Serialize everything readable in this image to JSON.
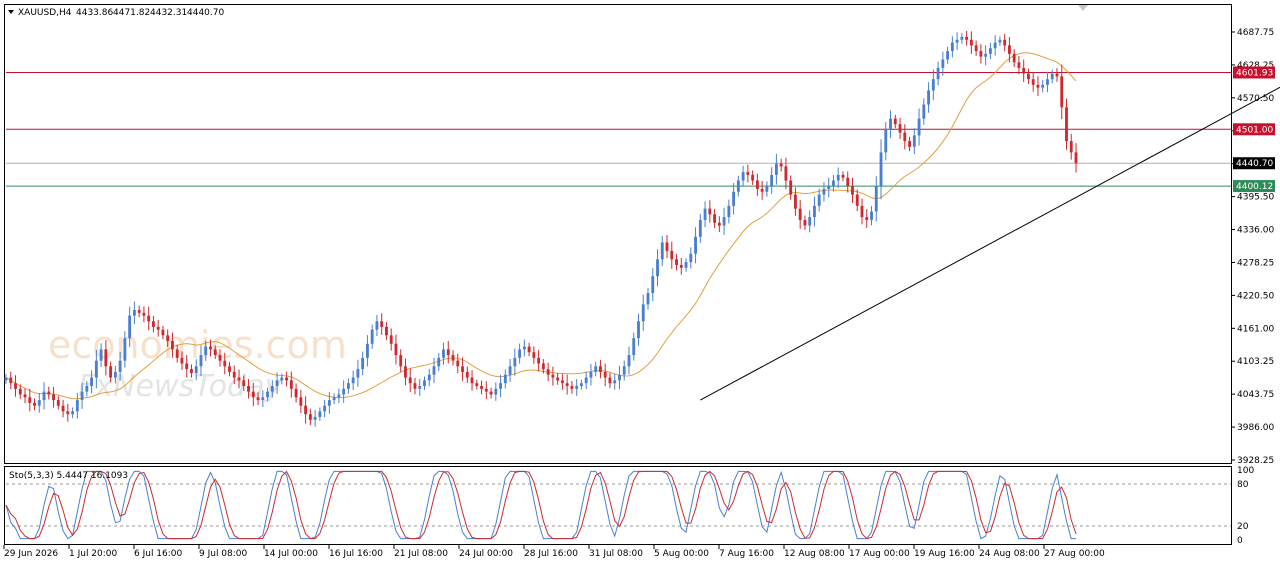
{
  "chart_data": {
    "type": "candlestick",
    "symbol_header": "XAUUSD,H4",
    "ohlc_header": [
      "4433.86",
      "4471.82",
      "4432.31",
      "4440.70"
    ],
    "price_axis": {
      "ylim": [
        3910,
        4720
      ],
      "ticks": [
        "4687.75",
        "4628.25",
        "4570.50",
        "4511.00",
        "4453.25",
        "4395.50",
        "4336.00",
        "4278.25",
        "4220.50",
        "4161.00",
        "4103.25",
        "4043.75",
        "3986.00",
        "3928.25"
      ]
    },
    "time_axis": {
      "ticks": [
        "29 Jun 2026",
        "1 Jul 20:00",
        "6 Jul 16:00",
        "9 Jul 08:00",
        "14 Jul 00:00",
        "16 Jul 16:00",
        "21 Jul 08:00",
        "24 Jul 00:00",
        "28 Jul 16:00",
        "31 Jul 08:00",
        "5 Aug 00:00",
        "7 Aug 16:00",
        "12 Aug 08:00",
        "17 Aug 00:00",
        "19 Aug 16:00",
        "24 Aug 08:00",
        "27 Aug 00:00"
      ]
    },
    "horizontal_levels": [
      {
        "value": 4601.93,
        "label": "4601.93",
        "color": "#c8102e"
      },
      {
        "value": 4501.0,
        "label": "4501.00",
        "color": "#c8102e"
      },
      {
        "value": 4440.7,
        "label": "4440.70",
        "color": "#000000",
        "line_color": "#b0b0b0"
      },
      {
        "value": 4400.12,
        "label": "4400.12",
        "color": "#2e8b57"
      }
    ],
    "trendline": {
      "from": [
        146,
        4020
      ],
      "to": [
        281,
        4670
      ],
      "x_unit": "bar index"
    },
    "close_series": [
      4060,
      4050,
      4040,
      4030,
      4025,
      4015,
      4010,
      4020,
      4035,
      4030,
      4020,
      4010,
      4000,
      3995,
      4000,
      4020,
      4035,
      4045,
      4060,
      4090,
      4110,
      4080,
      4060,
      4070,
      4090,
      4130,
      4170,
      4180,
      4175,
      4170,
      4160,
      4150,
      4145,
      4135,
      4125,
      4110,
      4095,
      4085,
      4075,
      4068,
      4080,
      4100,
      4115,
      4110,
      4100,
      4090,
      4080,
      4070,
      4060,
      4055,
      4045,
      4035,
      4025,
      4020,
      4025,
      4035,
      4045,
      4055,
      4060,
      4055,
      4040,
      4025,
      4010,
      3995,
      3985,
      3990,
      4000,
      4010,
      4020,
      4025,
      4030,
      4040,
      4050,
      4060,
      4075,
      4095,
      4120,
      4145,
      4160,
      4150,
      4135,
      4120,
      4100,
      4080,
      4060,
      4050,
      4040,
      4045,
      4055,
      4065,
      4080,
      4095,
      4110,
      4100,
      4090,
      4080,
      4070,
      4060,
      4050,
      4045,
      4040,
      4035,
      4030,
      4040,
      4050,
      4065,
      4080,
      4095,
      4110,
      4115,
      4105,
      4095,
      4085,
      4075,
      4065,
      4060,
      4055,
      4050,
      4045,
      4040,
      4045,
      4050,
      4060,
      4070,
      4080,
      4070,
      4060,
      4050,
      4055,
      4065,
      4080,
      4100,
      4130,
      4160,
      4190,
      4210,
      4240,
      4270,
      4300,
      4285,
      4270,
      4260,
      4255,
      4265,
      4280,
      4310,
      4340,
      4360,
      4350,
      4335,
      4330,
      4345,
      4365,
      4390,
      4410,
      4425,
      4420,
      4410,
      4395,
      4390,
      4400,
      4420,
      4440,
      4435,
      4410,
      4385,
      4360,
      4340,
      4330,
      4345,
      4365,
      4385,
      4395,
      4400,
      4410,
      4420,
      4415,
      4400,
      4385,
      4365,
      4345,
      4340,
      4355,
      4400,
      4460,
      4500,
      4520,
      4510,
      4495,
      4480,
      4470,
      4490,
      4520,
      4545,
      4570,
      4590,
      4610,
      4625,
      4640,
      4655,
      4660,
      4665,
      4660,
      4650,
      4640,
      4630,
      4635,
      4645,
      4655,
      4660,
      4650,
      4635,
      4620,
      4610,
      4600,
      4590,
      4580,
      4575,
      4580,
      4590,
      4600,
      4595,
      4540,
      4480,
      4460,
      4440.7
    ],
    "moving_average": "smooth orange line",
    "oscillator": {
      "label": "Sto(5,3,3) 5.4447 16.1093",
      "levels": [
        "100",
        "80",
        "20",
        "0"
      ],
      "ylim": [
        0,
        100
      ]
    }
  },
  "colors": {
    "bull": "#4a7fd0",
    "bear": "#d0282e",
    "ma": "#e0a040",
    "trend": "#000000",
    "sto_main": "#4a7fd0",
    "sto_signal": "#d0282e",
    "grid_dash": "#9a9a9a"
  },
  "watermark": {
    "line1": "economies.com",
    "line2": "FxNewsToday"
  }
}
